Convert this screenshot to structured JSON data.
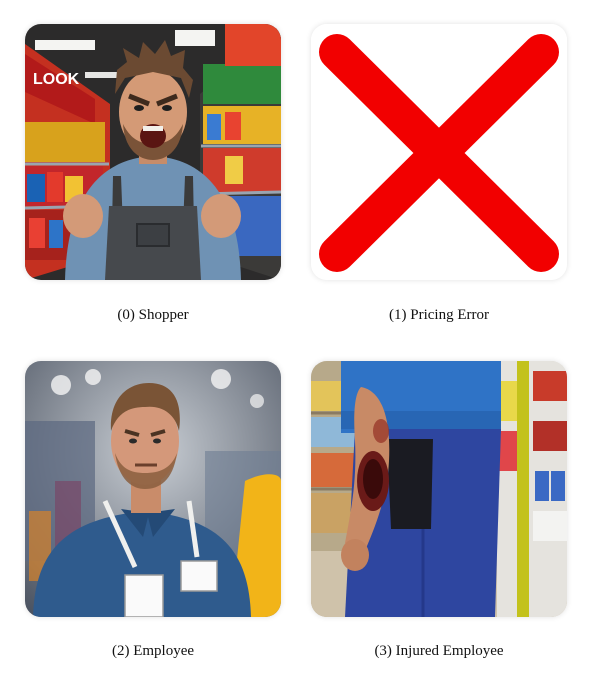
{
  "panels": [
    {
      "caption": "(0) Shopper",
      "image": "angry-shopper-in-supermarket-aisle",
      "store_sign": "LOOK"
    },
    {
      "caption": "(1) Pricing Error",
      "image": "red-x-mark",
      "mark_color": "#f20000"
    },
    {
      "caption": "(2) Employee",
      "image": "worried-employee-with-lanyard-badge"
    },
    {
      "caption": "(3) Injured Employee",
      "image": "employee-with-injured-forearm"
    }
  ]
}
